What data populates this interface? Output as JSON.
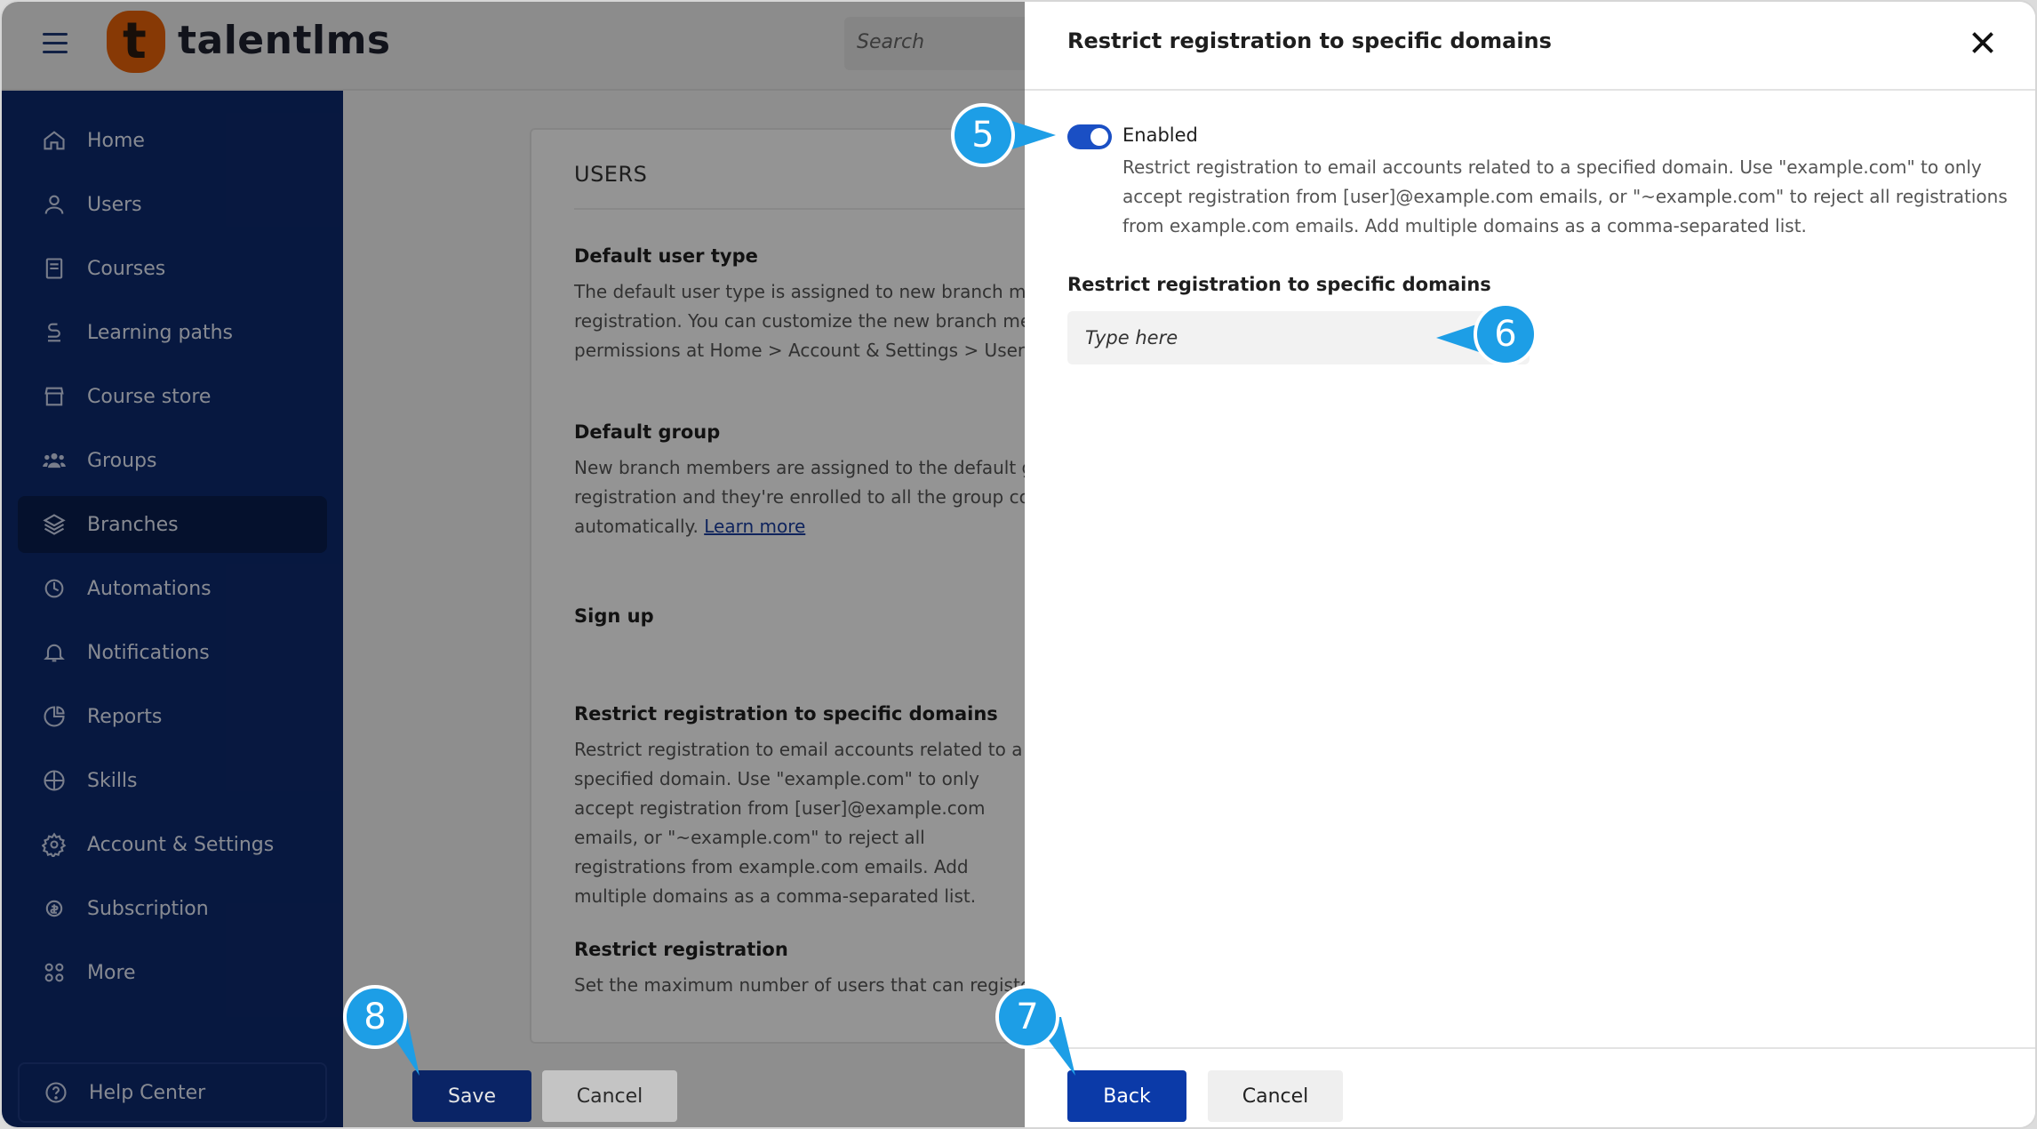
{
  "app": {
    "brand": "talentlms",
    "search_placeholder": "Search"
  },
  "sidebar": {
    "items": [
      {
        "label": "Home",
        "icon": "home-icon"
      },
      {
        "label": "Users",
        "icon": "user-icon"
      },
      {
        "label": "Courses",
        "icon": "book-icon"
      },
      {
        "label": "Learning paths",
        "icon": "path-icon"
      },
      {
        "label": "Course store",
        "icon": "store-icon"
      },
      {
        "label": "Groups",
        "icon": "groups-icon"
      },
      {
        "label": "Branches",
        "icon": "layers-icon",
        "active": true
      },
      {
        "label": "Automations",
        "icon": "automation-icon"
      },
      {
        "label": "Notifications",
        "icon": "bell-icon"
      },
      {
        "label": "Reports",
        "icon": "pie-icon"
      },
      {
        "label": "Skills",
        "icon": "skills-icon"
      },
      {
        "label": "Account & Settings",
        "icon": "gear-icon"
      },
      {
        "label": "Subscription",
        "icon": "subscription-icon"
      },
      {
        "label": "More",
        "icon": "grid-icon"
      }
    ],
    "help": "Help Center"
  },
  "main": {
    "title": "USERS",
    "sections": [
      {
        "heading": "Default user type",
        "text": "The default user type is assigned to new branch members on registration. You can customize the new branch member's permissions at Home > Account & Settings > User types."
      },
      {
        "heading": "Default group",
        "text": "New branch members are assigned to the default group on registration and they're enrolled to all the group courses automatically.",
        "link": "Learn more"
      },
      {
        "heading": "Sign up",
        "text": ""
      },
      {
        "heading": "Restrict registration to specific domains",
        "text": "Restrict registration to email accounts related to a specified domain. Use \"example.com\" to only accept registration from [user]@example.com emails, or \"~example.com\" to reject all registrations from example.com emails. Add multiple domains as a comma-separated list."
      },
      {
        "heading": "Restrict registration",
        "text": "Set the maximum number of users that can register to this branch."
      }
    ],
    "save_label": "Save",
    "cancel_label": "Cancel"
  },
  "drawer": {
    "title": "Restrict registration to specific domains",
    "toggle_label": "Enabled",
    "description": "Restrict registration to email accounts related to a specified domain. Use \"example.com\" to only accept registration from [user]@example.com emails, or \"~example.com\" to reject all registrations from example.com emails. Add multiple domains as a comma-separated list.",
    "field_label": "Restrict registration to specific domains",
    "field_placeholder": "Type here",
    "back_label": "Back",
    "cancel_label": "Cancel"
  },
  "callouts": {
    "c5": "5",
    "c6": "6",
    "c7": "7",
    "c8": "8"
  },
  "colors": {
    "sidebar": "#0d2a6e",
    "primary": "#0b3aa8",
    "callout": "#1d9ee6",
    "brand_orange": "#e8630a"
  }
}
